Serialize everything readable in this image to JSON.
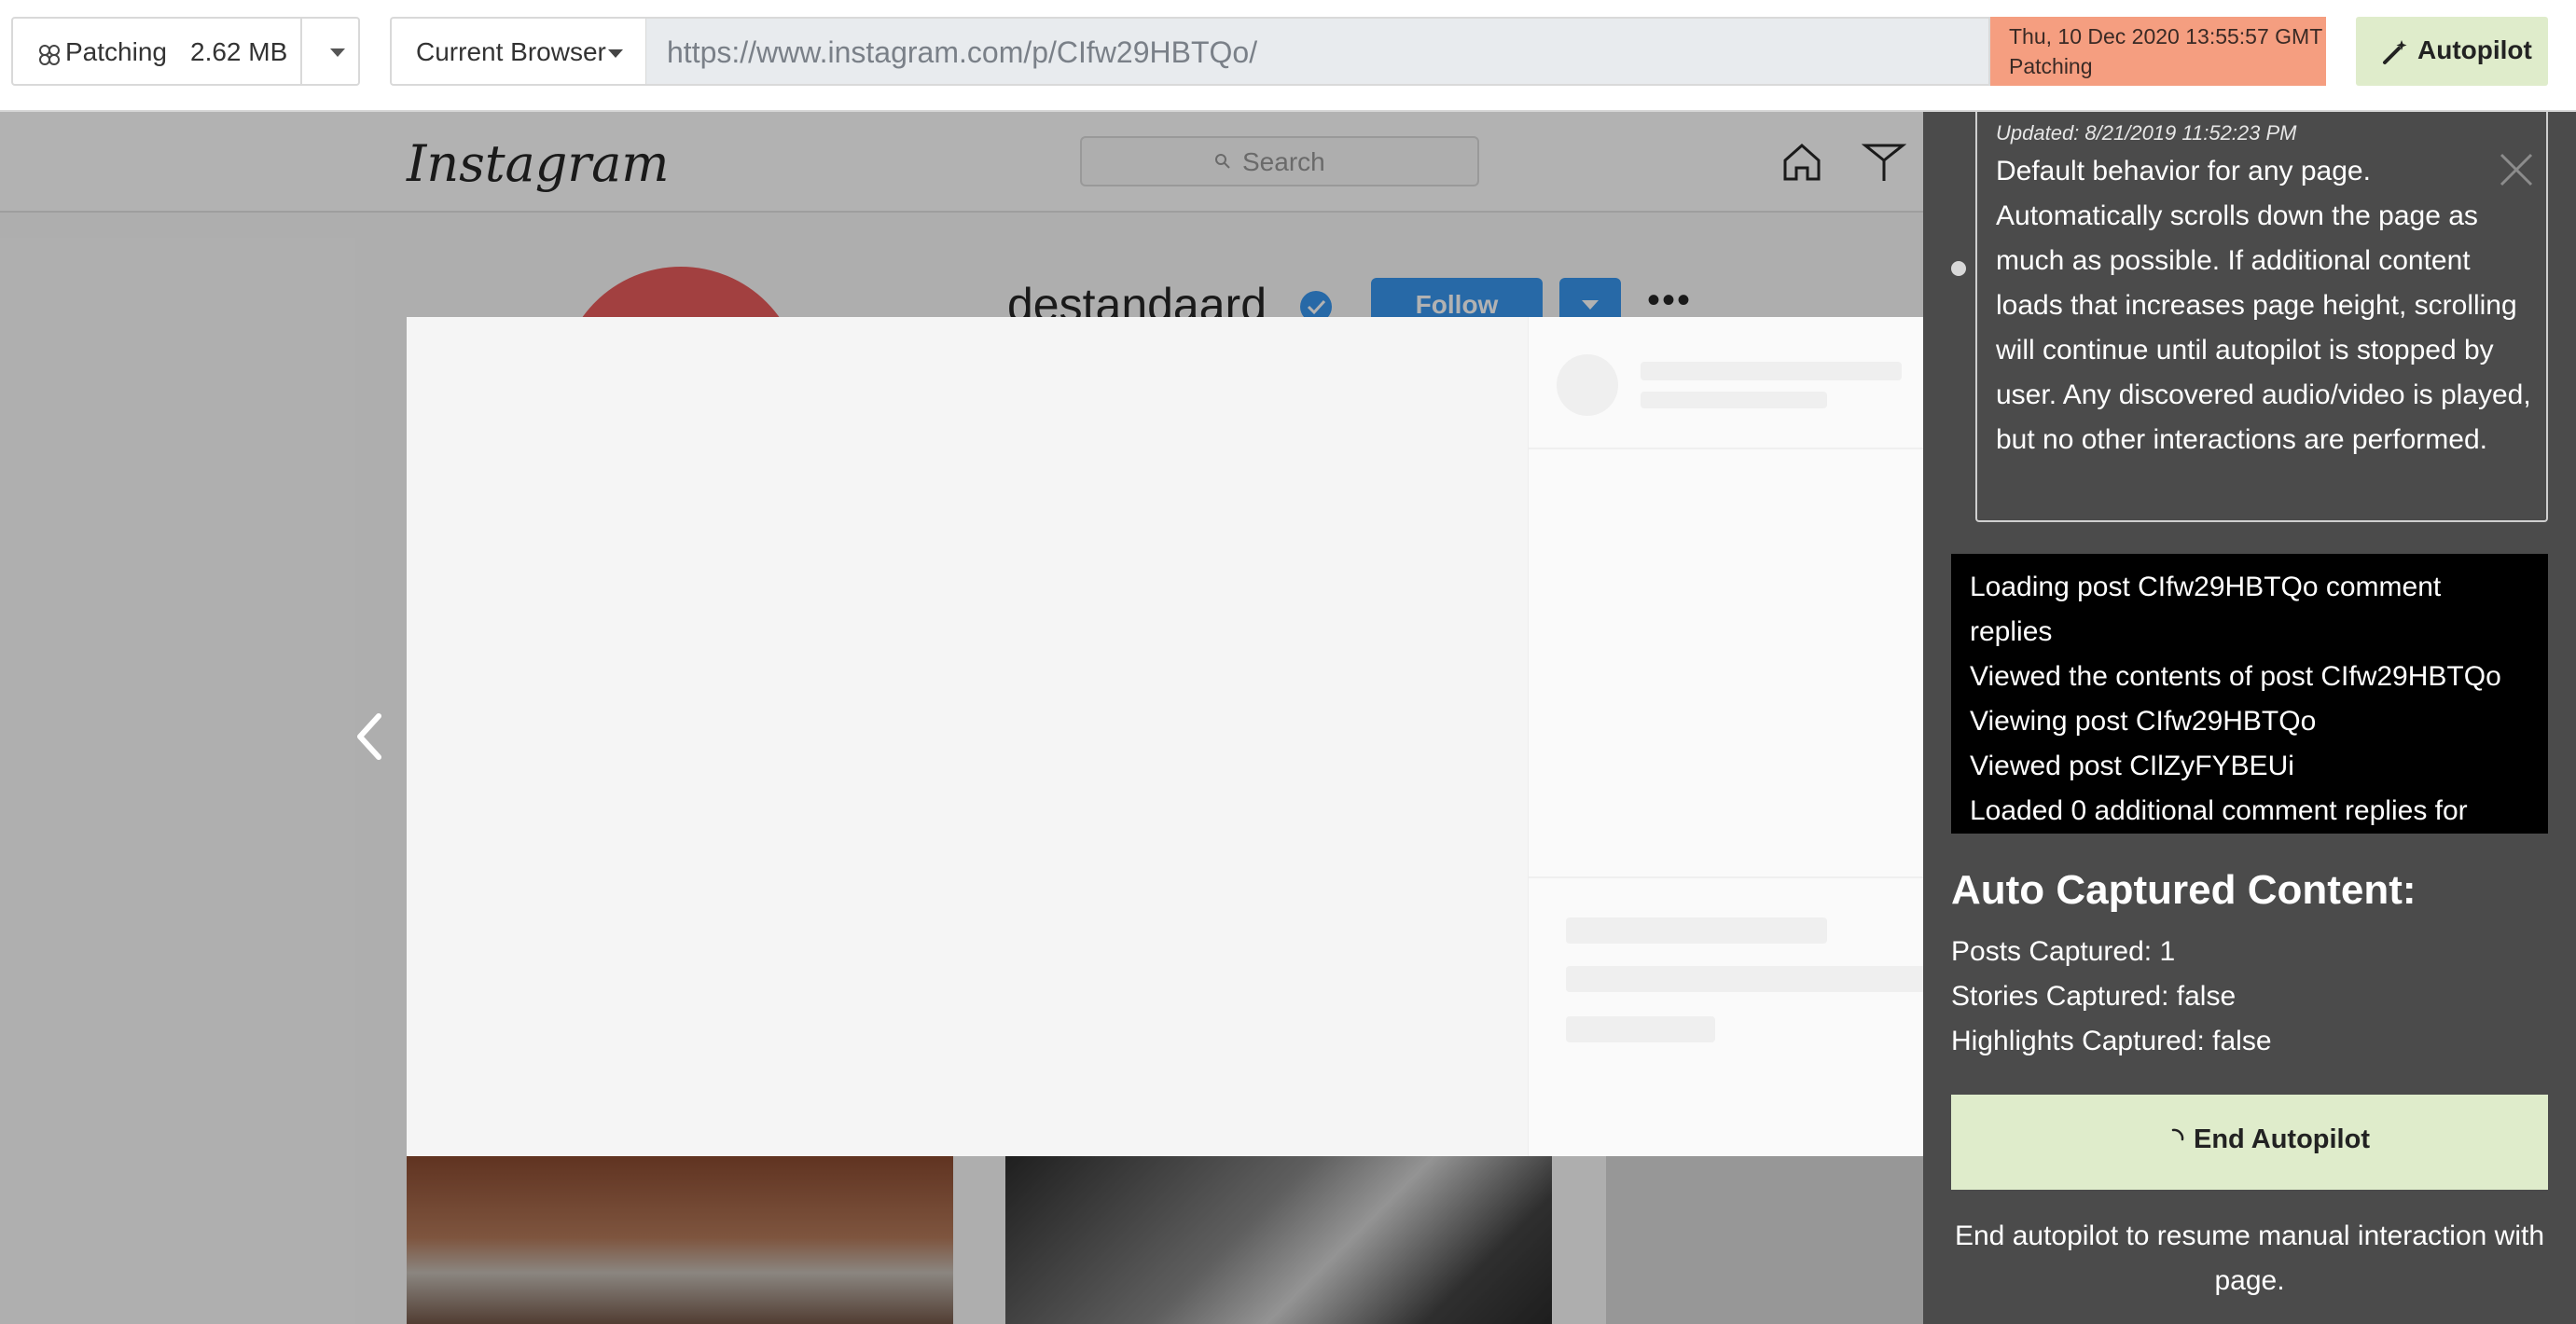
{
  "toolbar": {
    "status_label": "Patching",
    "status_size": "2.62 MB",
    "browser_select": "Current Browser",
    "url": "https://www.instagram.com/p/CIfw29HBTQo/",
    "timestamp": "Thu, 10 Dec 2020 13:55:57 GMT",
    "timestamp_status": "Patching",
    "autopilot_label": "Autopilot"
  },
  "instagram": {
    "logo": "Instagram",
    "search_placeholder": "Search",
    "profile_name": "destandaard",
    "follow_label": "Follow",
    "more_label": "•••"
  },
  "panel": {
    "updated": "Updated: 8/21/2019 11:52:23 PM",
    "description": "Default behavior for any page. Automatically scrolls down the page as much as possible. If additional content loads that increases page height, scrolling will continue until autopilot is stopped by user. Any discovered audio/video is played, but no other interactions are performed.",
    "log": [
      "Loading post CIfw29HBTQo comment",
      "replies",
      "Viewed the contents of post CIfw29HBTQo",
      "Viewing post CIfw29HBTQo",
      "Viewed post CIlZyFYBEUi",
      "Loaded 0 additional comment replies for"
    ],
    "auto_captured_title": "Auto Captured Content:",
    "stats": [
      "Posts Captured: 1",
      "Stories Captured: false",
      "Highlights Captured: false"
    ],
    "end_button": "End Autopilot",
    "end_note": "End autopilot to resume manual interaction with page."
  },
  "colors": {
    "accent_green": "#dfeccb",
    "timestamp_bg": "#f59e80",
    "panel_bg": "#4b4b4b",
    "instagram_blue": "#3897f0"
  },
  "icons": [
    "patching-icon",
    "magic-wand-icon",
    "search-icon",
    "home-icon",
    "direct-icon",
    "explore-icon",
    "verified-icon",
    "chevron-left-icon",
    "close-icon",
    "spinner-icon"
  ]
}
